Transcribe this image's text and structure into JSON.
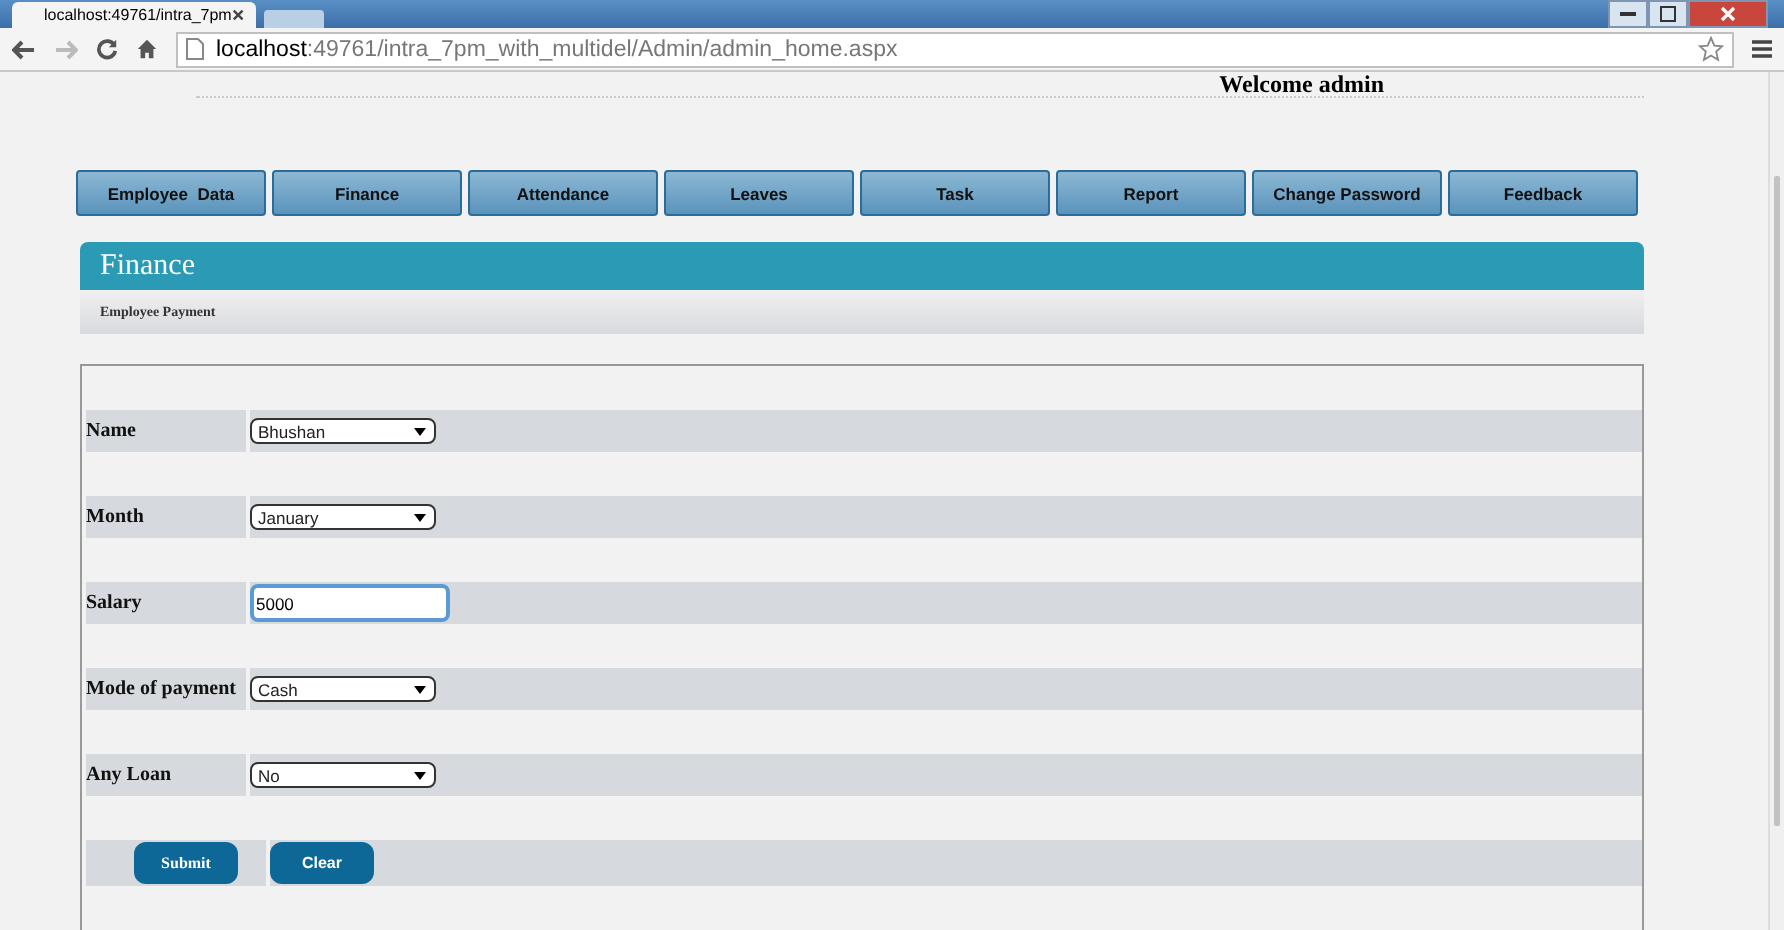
{
  "browser": {
    "tab_title": "localhost:49761/intra_7pm",
    "url_host": "localhost",
    "url_path": ":49761/intra_7pm_with_multidel/Admin/admin_home.aspx"
  },
  "welcome": "Welcome admin",
  "nav": [
    {
      "label": "Employee  Data"
    },
    {
      "label": "Finance"
    },
    {
      "label": "Attendance"
    },
    {
      "label": "Leaves"
    },
    {
      "label": "Task"
    },
    {
      "label": "Report"
    },
    {
      "label": "Change Password"
    },
    {
      "label": "Feedback"
    }
  ],
  "panel": {
    "title": "Finance",
    "subtitle": "Employee Payment"
  },
  "fields": [
    {
      "label": "Name",
      "kind": "select",
      "value": "Bhushan",
      "focused": false
    },
    {
      "label": "Month",
      "kind": "select",
      "value": "January",
      "focused": false
    },
    {
      "label": "Salary",
      "kind": "text",
      "value": "5000",
      "focused": true
    },
    {
      "label": "Mode of payment",
      "kind": "select",
      "value": "Cash",
      "focused": false
    },
    {
      "label": "Any Loan",
      "kind": "select",
      "value": "No",
      "focused": false
    }
  ],
  "buttons": [
    "Submit",
    "Clear"
  ]
}
